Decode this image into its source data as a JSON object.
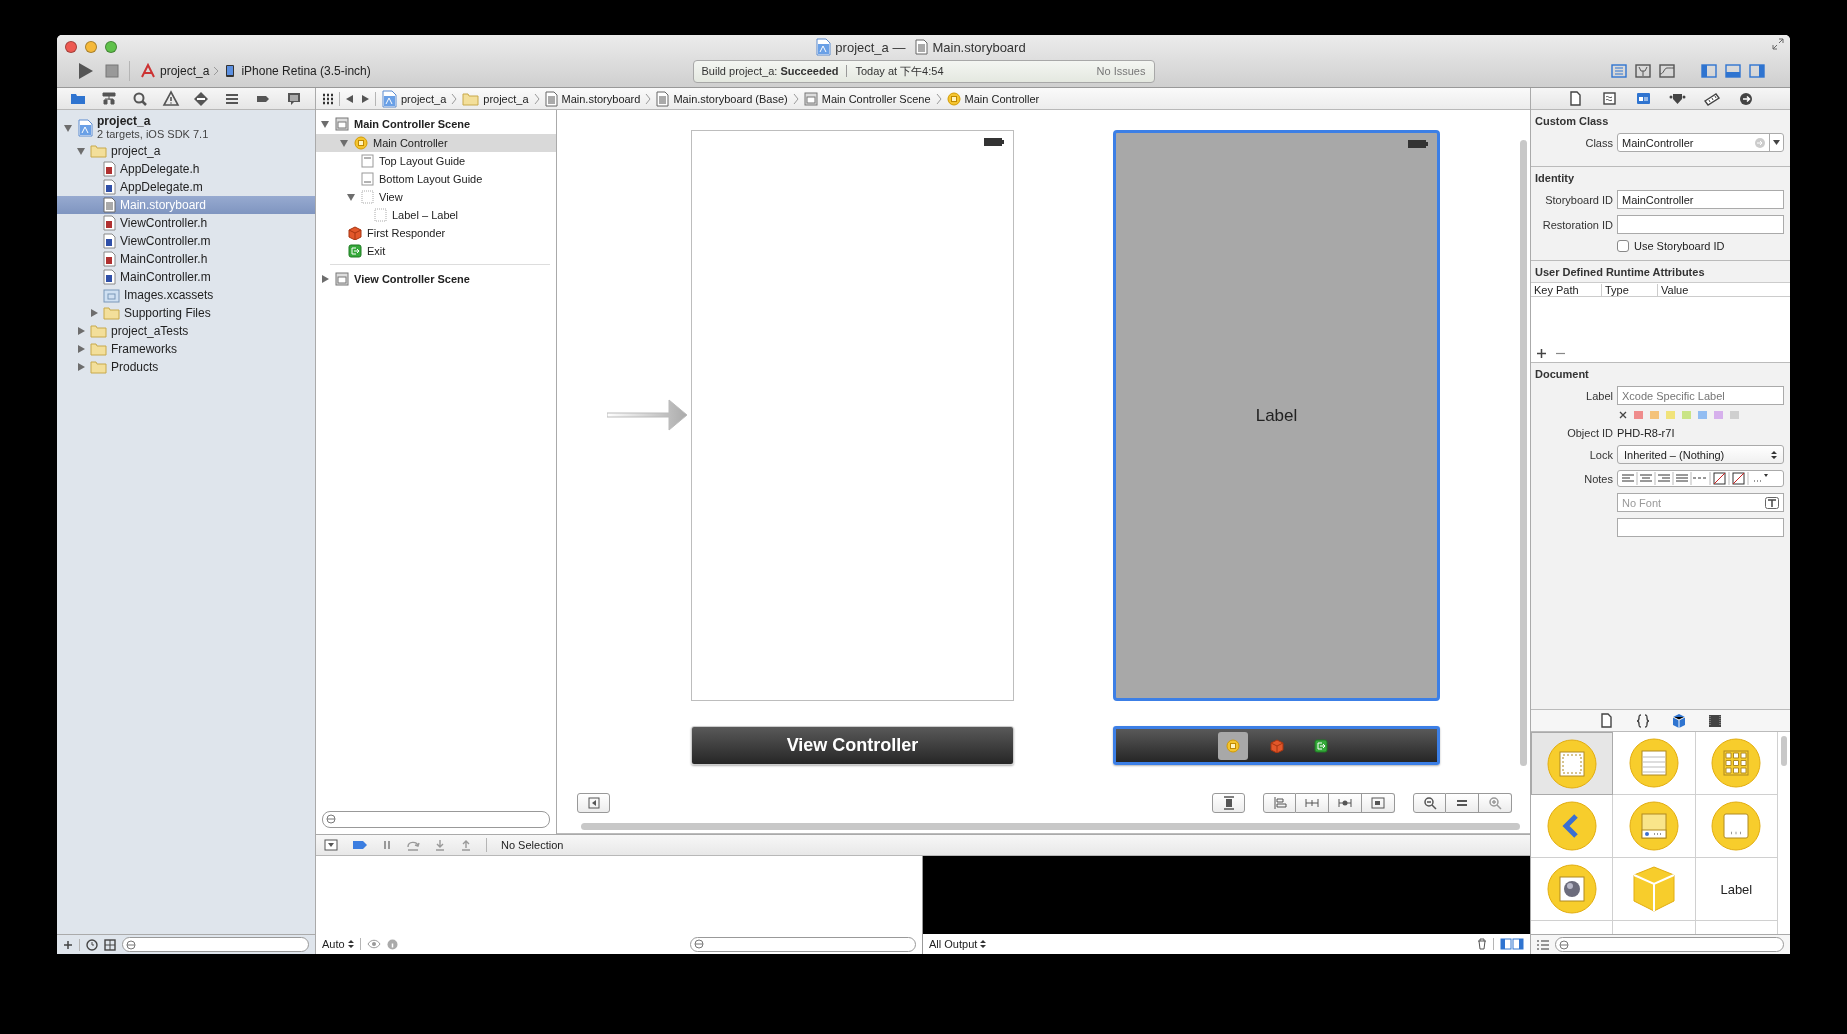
{
  "window": {
    "title_parts": [
      {
        "kind": "project",
        "text": "project_a —"
      },
      {
        "kind": "storyboard",
        "text": "Main.storyboard"
      }
    ]
  },
  "toolbar": {
    "scheme": {
      "project": "project_a",
      "destination": "iPhone Retina (3.5-inch)"
    },
    "activity": {
      "status": "Build project_a: **Succeeded**",
      "time": "Today at 下午4:54",
      "issues": "No Issues"
    },
    "editor_modes": [
      {
        "kind": "standard",
        "selected": true
      },
      {
        "kind": "assistant",
        "selected": false
      },
      {
        "kind": "version",
        "selected": false
      }
    ],
    "panels": [
      {
        "kind": "navigator",
        "on": true
      },
      {
        "kind": "debug",
        "on": true
      },
      {
        "kind": "utilities",
        "on": true
      }
    ]
  },
  "navigator": {
    "tabs": [
      {
        "kind": "project",
        "selected": true
      },
      {
        "kind": "symbol",
        "selected": false
      },
      {
        "kind": "find",
        "selected": false
      },
      {
        "kind": "issue",
        "selected": false
      },
      {
        "kind": "test",
        "selected": false
      },
      {
        "kind": "debug",
        "selected": false
      },
      {
        "kind": "breakpoint",
        "selected": false
      },
      {
        "kind": "log",
        "selected": false
      }
    ],
    "tree": [
      {
        "label": "project_a",
        "subtitle": "2 targets, iOS SDK 7.1",
        "kind": "project",
        "expanded": true,
        "selected": false,
        "children": [
          {
            "label": "project_a",
            "kind": "folder",
            "expanded": true,
            "selected": false,
            "children": [
              {
                "label": "AppDelegate.h",
                "kind": "header",
                "selected": false
              },
              {
                "label": "AppDelegate.m",
                "kind": "source",
                "selected": false
              },
              {
                "label": "Main.storyboard",
                "kind": "storyboard",
                "selected": true
              },
              {
                "label": "ViewController.h",
                "kind": "header",
                "selected": false
              },
              {
                "label": "ViewController.m",
                "kind": "source",
                "selected": false
              },
              {
                "label": "MainController.h",
                "kind": "header",
                "selected": false
              },
              {
                "label": "MainController.m",
                "kind": "source",
                "selected": false
              },
              {
                "label": "Images.xcassets",
                "kind": "assets",
                "selected": false
              },
              {
                "label": "Supporting Files",
                "kind": "folder",
                "expanded": false,
                "selected": false
              }
            ]
          },
          {
            "label": "project_aTests",
            "kind": "folder",
            "expanded": false,
            "selected": false
          },
          {
            "label": "Frameworks",
            "kind": "folder",
            "expanded": false,
            "selected": false
          },
          {
            "label": "Products",
            "kind": "folder",
            "expanded": false,
            "selected": false
          }
        ]
      }
    ]
  },
  "jump_bar": [
    {
      "label": "project_a",
      "kind": "project"
    },
    {
      "label": "project_a",
      "kind": "folder"
    },
    {
      "label": "Main.storyboard",
      "kind": "storyboard"
    },
    {
      "label": "Main.storyboard (Base)",
      "kind": "storyboard"
    },
    {
      "label": "Main Controller Scene",
      "kind": "scene"
    },
    {
      "label": "Main Controller",
      "kind": "controller"
    }
  ],
  "outline": [
    {
      "label": "Main Controller Scene",
      "kind": "scene",
      "expanded": true,
      "selected": false,
      "children": [
        {
          "label": "Main Controller",
          "kind": "controller",
          "expanded": true,
          "selected": true,
          "children": [
            {
              "label": "Top Layout Guide",
              "kind": "top-guide",
              "selected": false
            },
            {
              "label": "Bottom Layout Guide",
              "kind": "bottom-guide",
              "selected": false
            },
            {
              "label": "View",
              "kind": "view",
              "expanded": true,
              "selected": false,
              "children": [
                {
                  "label": "Label – Label",
                  "kind": "view",
                  "selected": false
                }
              ]
            }
          ]
        },
        {
          "label": "First Responder",
          "kind": "responder",
          "selected": false
        },
        {
          "label": "Exit",
          "kind": "exit",
          "selected": false
        }
      ]
    },
    {
      "label": "View Controller Scene",
      "kind": "scene",
      "expanded": false,
      "selected": false
    }
  ],
  "canvas": {
    "scenes": [
      {
        "initial": true,
        "selected": false,
        "color": "#ffffff",
        "dock_title": "View Controller"
      },
      {
        "initial": false,
        "selected": true,
        "color": "#a8a8a8",
        "label": "Label",
        "dock_icons": [
          {
            "kind": "controller",
            "selected": true
          },
          {
            "kind": "responder",
            "selected": false
          },
          {
            "kind": "exit",
            "selected": false
          }
        ]
      }
    ]
  },
  "debug": {
    "status": "No Selection",
    "scope": "Auto",
    "output": "All Output"
  },
  "inspector": {
    "tabs": [
      {
        "kind": "file",
        "selected": false
      },
      {
        "kind": "help",
        "selected": false
      },
      {
        "kind": "identity",
        "selected": true
      },
      {
        "kind": "attributes",
        "selected": false
      },
      {
        "kind": "size",
        "selected": false
      },
      {
        "kind": "connections",
        "selected": false
      }
    ],
    "custom_class": {
      "title": "Custom Class",
      "class_label": "Class",
      "class_value": "MainController"
    },
    "identity": {
      "title": "Identity",
      "storyboard_id_label": "Storyboard ID",
      "storyboard_id": "MainController",
      "restoration_id_label": "Restoration ID",
      "use_storyboard_id": {
        "label": "Use Storyboard ID",
        "checked": false
      }
    },
    "runtime_attributes": {
      "title": "User Defined Runtime Attributes",
      "columns": [
        "Key Path",
        "Type",
        "Value"
      ]
    },
    "document": {
      "title": "Document",
      "label_label": "Label",
      "label_placeholder": "Xcode Specific Label",
      "label_colors": [
        {
          "color": "#ef8c8c"
        },
        {
          "color": "#f4c27a"
        },
        {
          "color": "#f1e37a"
        },
        {
          "color": "#c9e486"
        },
        {
          "color": "#92bdf2"
        },
        {
          "color": "#d6b0ec"
        },
        {
          "color": "#cfcfcf"
        }
      ],
      "object_id_label": "Object ID",
      "object_id": "PHD-R8-r7I",
      "lock_label": "Lock",
      "lock_value": "Inherited – (Nothing)",
      "notes_label": "Notes",
      "font_placeholder": "No Font"
    }
  },
  "library": {
    "tabs": [
      {
        "kind": "file",
        "selected": false
      },
      {
        "kind": "snippet",
        "selected": false
      },
      {
        "kind": "object",
        "selected": true
      },
      {
        "kind": "media",
        "selected": false
      }
    ],
    "items": [
      {
        "kind": "view-controller",
        "selected": true
      },
      {
        "kind": "table-controller",
        "selected": false
      },
      {
        "kind": "collection-controller",
        "selected": false
      },
      {
        "kind": "navigation-controller",
        "selected": false
      },
      {
        "kind": "tabbar-controller",
        "selected": false
      },
      {
        "kind": "page-controller",
        "selected": false
      },
      {
        "kind": "glkit-controller",
        "selected": false
      },
      {
        "kind": "object",
        "selected": false
      },
      {
        "kind": "text",
        "text": "Label",
        "selected": false
      }
    ]
  }
}
